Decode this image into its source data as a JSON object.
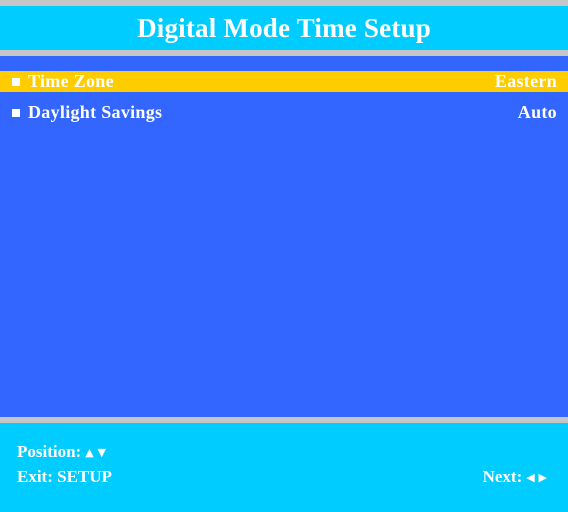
{
  "title": "Digital Mode Time Setup",
  "menu": {
    "items": [
      {
        "label": "Time Zone",
        "value": "Eastern",
        "selected": true
      },
      {
        "label": "Daylight Savings",
        "value": "Auto",
        "selected": false
      }
    ]
  },
  "help": {
    "position_label": "Position:",
    "exit_label": "Exit: SETUP",
    "next_label": "Next:"
  },
  "icons": {
    "bullet": "square-bullet-icon",
    "up_down": "up-down-arrows-icon",
    "left_right": "left-right-arrows-icon"
  },
  "colors": {
    "title_bg": "#00ccff",
    "menu_bg": "#3366ff",
    "highlight": "#ffcc00",
    "rule": "#c6c6c6",
    "text": "#ffffff"
  }
}
